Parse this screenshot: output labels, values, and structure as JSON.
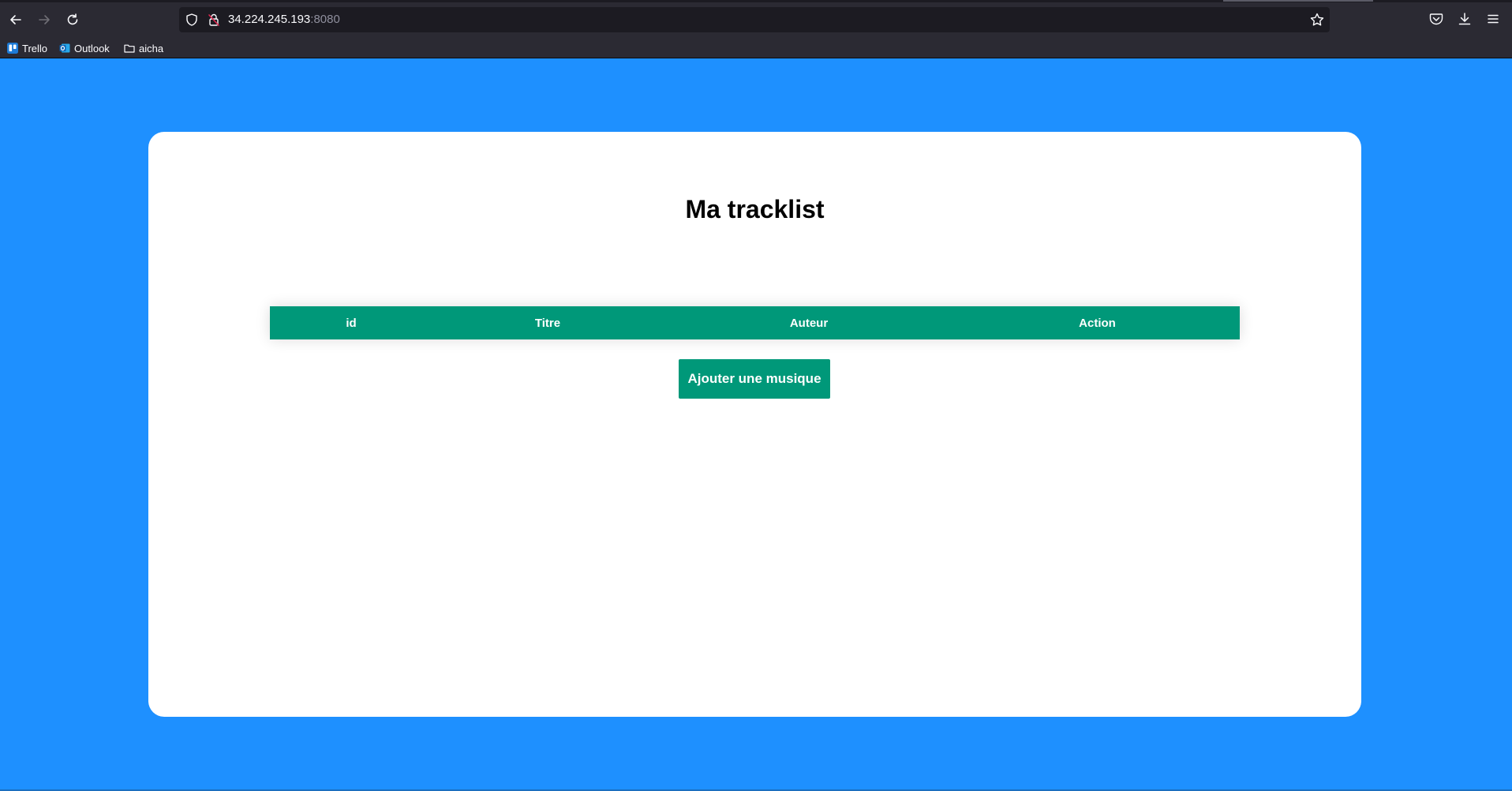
{
  "browser": {
    "url_host": "34.224.245.193",
    "url_port": ":8080",
    "bookmarks": [
      {
        "label": "Trello",
        "icon": "trello-icon"
      },
      {
        "label": "Outlook",
        "icon": "outlook-icon"
      },
      {
        "label": "aicha",
        "icon": "folder-icon"
      }
    ],
    "colors": {
      "chrome": "#2b2a33",
      "urlbar": "#1c1b22"
    }
  },
  "page": {
    "title": "Ma tracklist",
    "table": {
      "columns": [
        "id",
        "Titre",
        "Auteur",
        "Action"
      ],
      "rows": []
    },
    "add_button_label": "Ajouter une musique",
    "colors": {
      "background": "#1e90ff",
      "accent": "#009879",
      "card": "#ffffff"
    }
  }
}
